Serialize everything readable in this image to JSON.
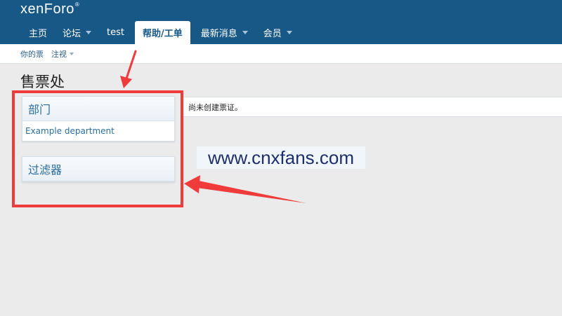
{
  "header": {
    "logo_text": "xenForo",
    "logo_mark": "®"
  },
  "nav": {
    "tabs": [
      {
        "label": "主页",
        "has_menu": false
      },
      {
        "label": "论坛",
        "has_menu": true
      },
      {
        "label": "test",
        "has_menu": false
      },
      {
        "label": "帮助/工单",
        "has_menu": false,
        "active": true
      },
      {
        "label": "最新消息",
        "has_menu": true
      },
      {
        "label": "会员",
        "has_menu": true
      }
    ]
  },
  "subnav": {
    "items": [
      {
        "label": "你的票",
        "has_menu": false
      },
      {
        "label": "注视",
        "has_menu": true
      }
    ]
  },
  "page": {
    "title": "售票处"
  },
  "sidebar": {
    "departments": {
      "title": "部门",
      "items": [
        "Example department"
      ]
    },
    "filters": {
      "title": "过滤器"
    }
  },
  "main": {
    "notice": "尚未创建票证。"
  },
  "watermark": {
    "text": "www.cnxfans.com"
  },
  "colors": {
    "header_bg": "#185886",
    "accent": "#2b6e9e",
    "annotation": "#f03b3b"
  }
}
